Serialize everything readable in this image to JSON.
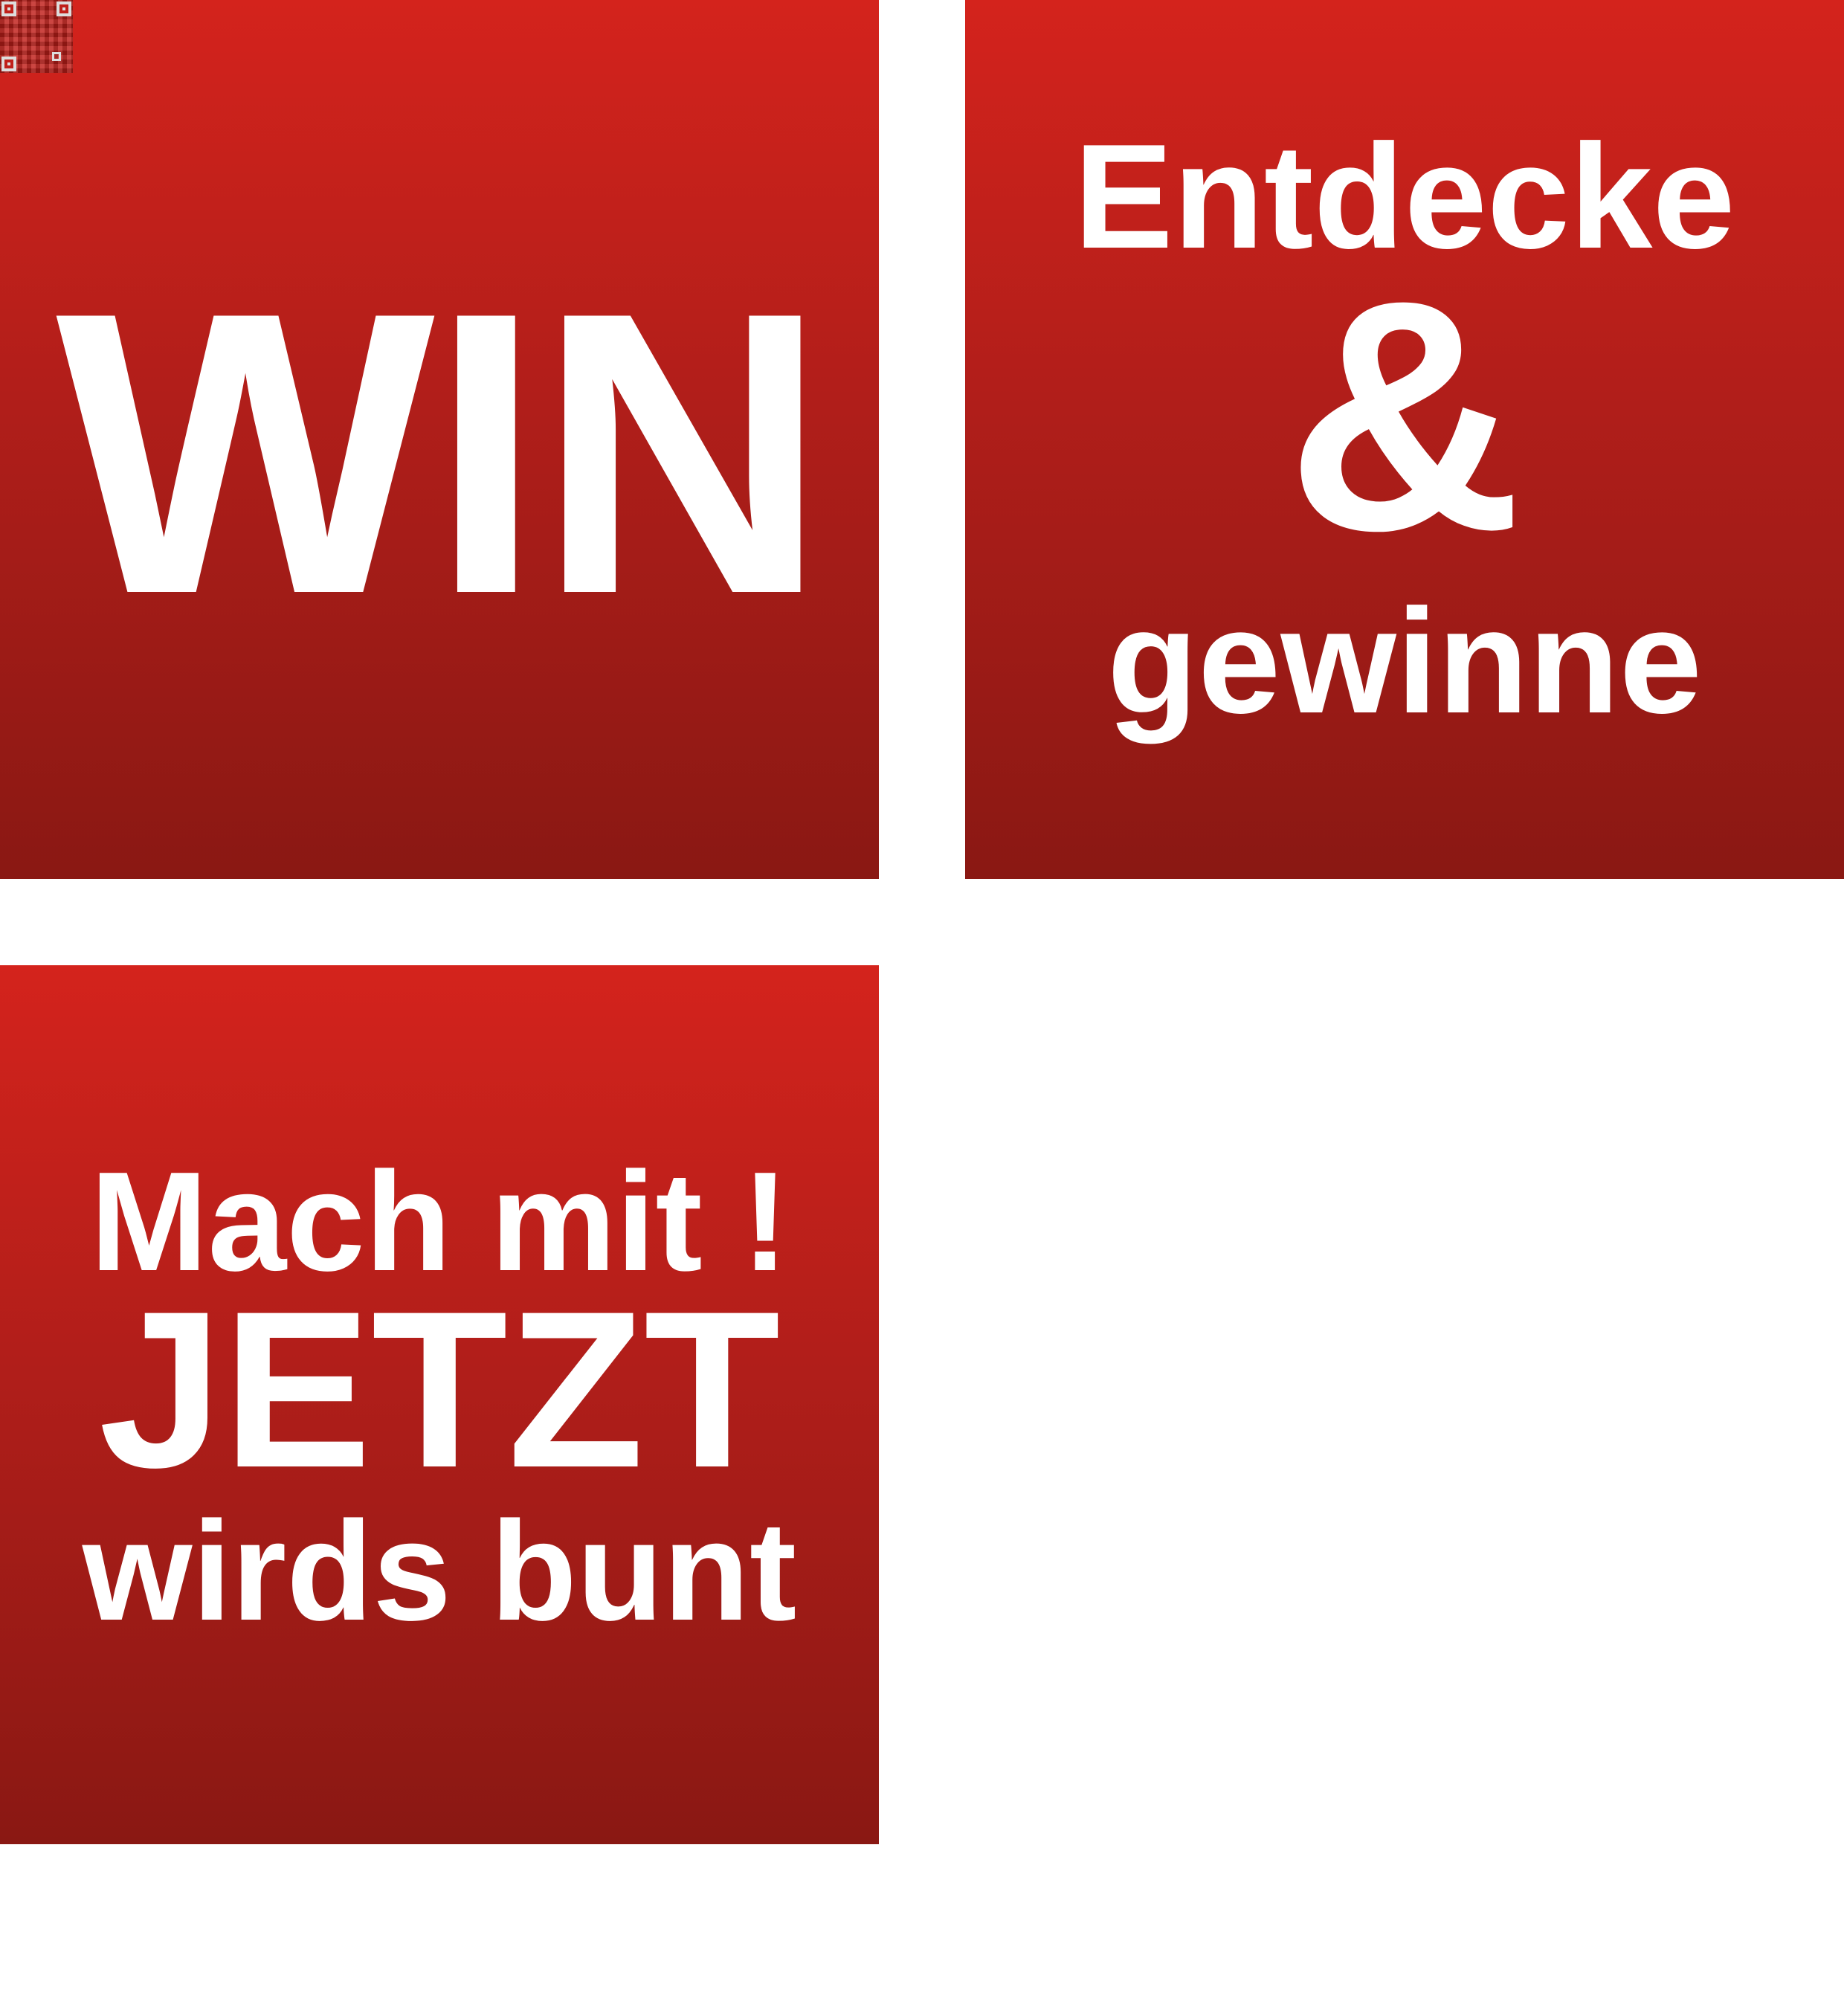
{
  "colors": {
    "tile_top": "#d4231c",
    "tile_bottom": "#8a1813",
    "text": "#ffffff",
    "background": "#ffffff"
  },
  "tiles": {
    "win": {
      "text": "WIN"
    },
    "entdecke": {
      "line1": "Entdecke",
      "ampersand": "&",
      "line3": "gewinne"
    },
    "machmit": {
      "line1": "Mach mit !",
      "line2": "JETZT",
      "line3": "wirds bunt"
    }
  },
  "qr_code": {
    "icon": "qr-code-icon"
  }
}
